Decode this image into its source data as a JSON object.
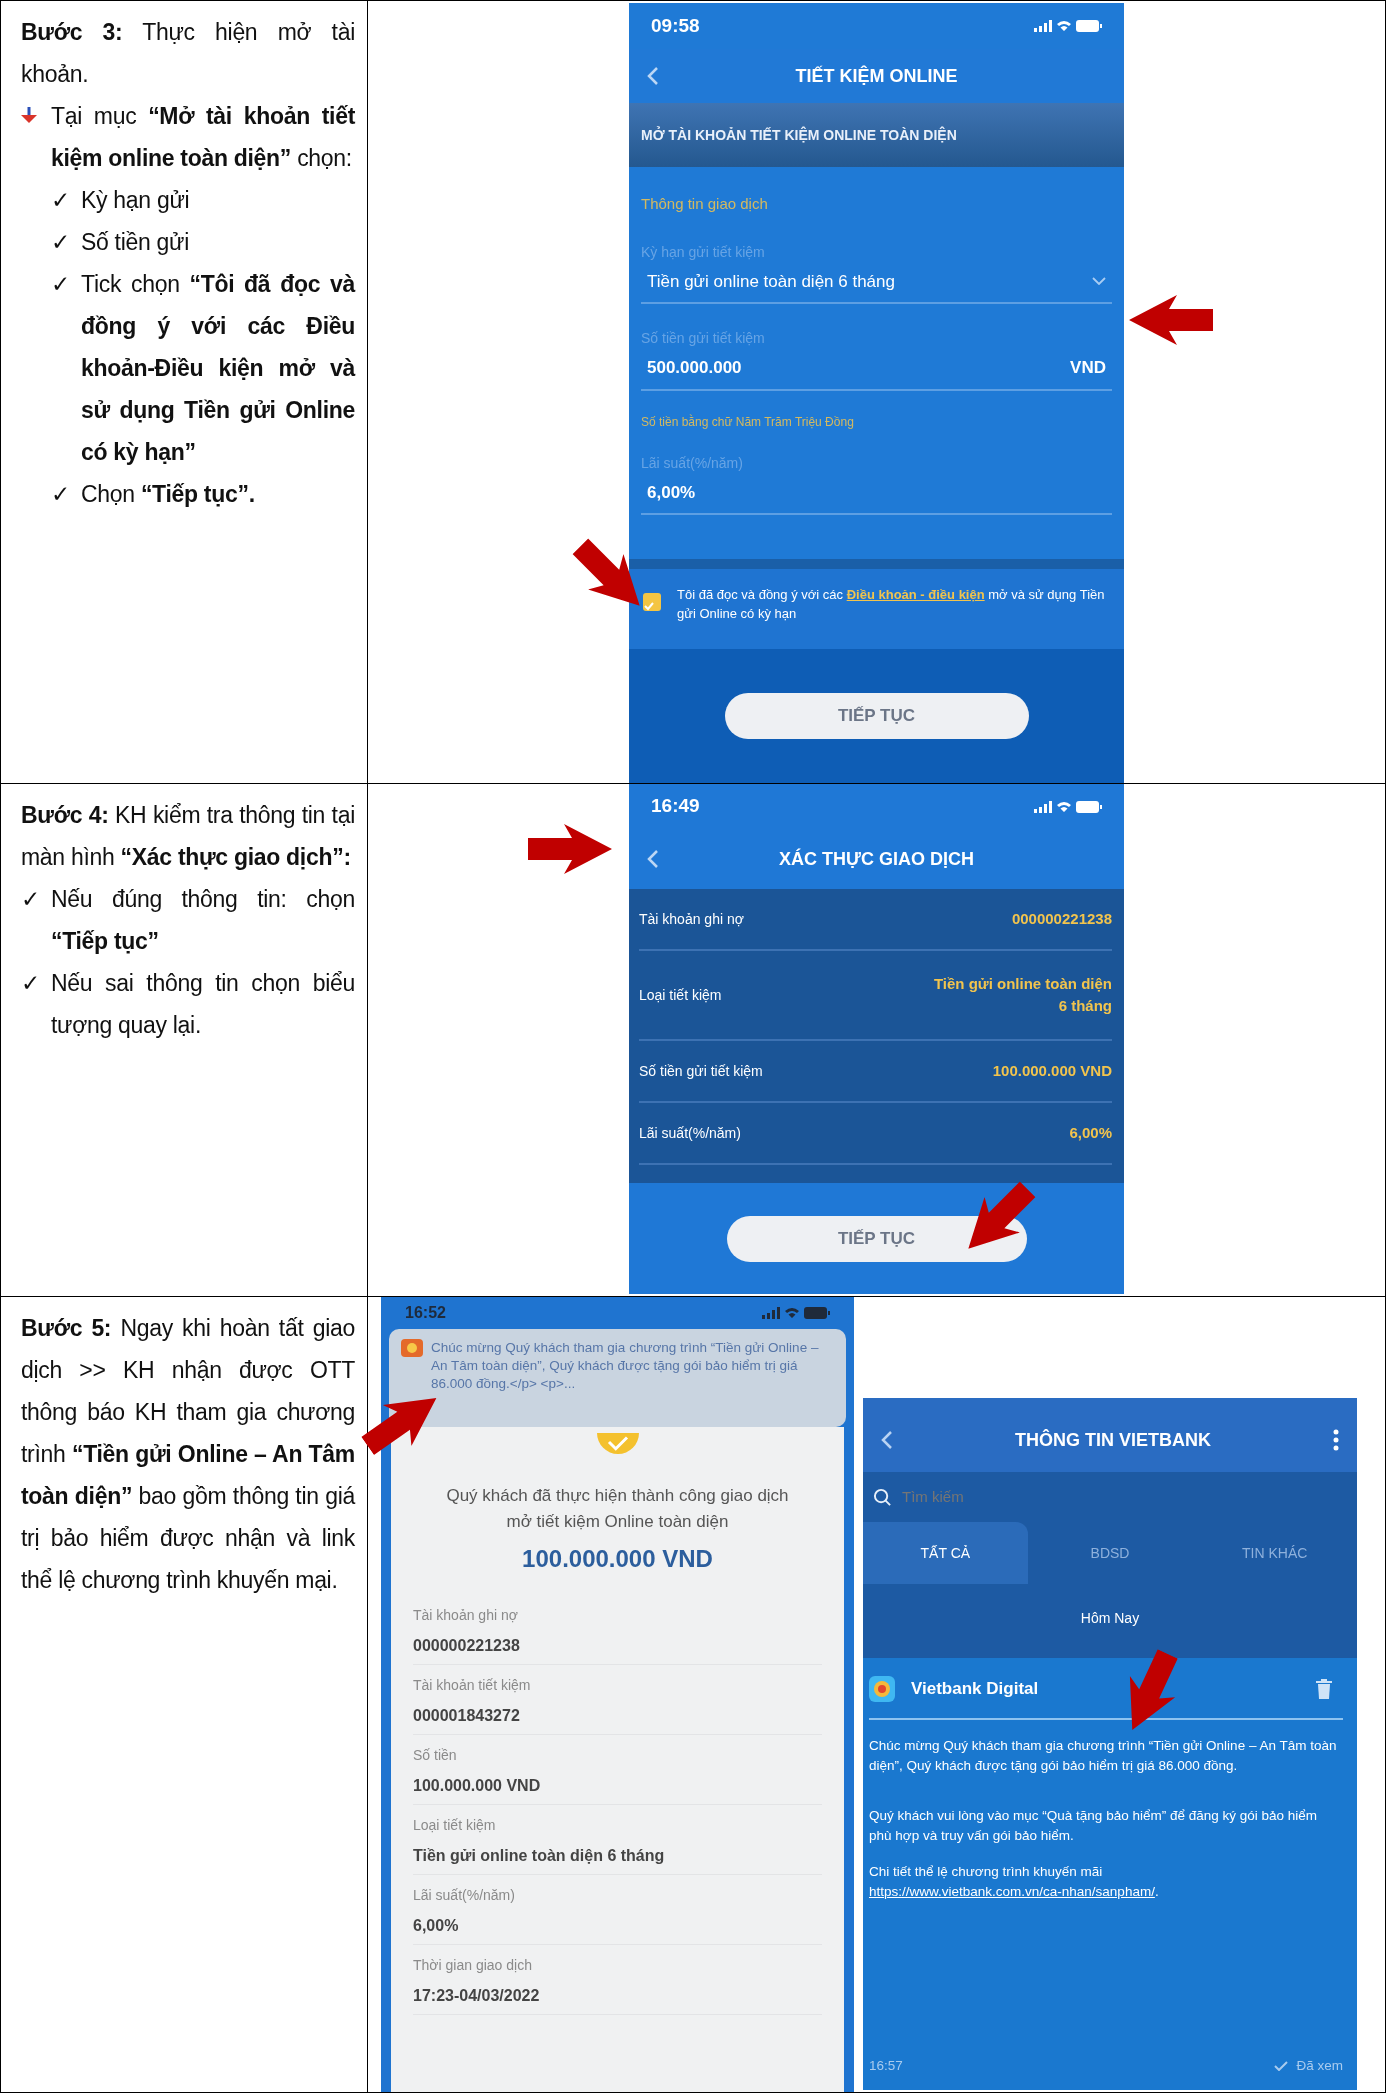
{
  "rows": [
    {
      "instruction": {
        "heading": "**Bước 3:** Thực hiện mở tài khoản.",
        "items": [
          {
            "kind": "arrow",
            "text": "Tại mục **“Mở tài khoản tiết kiệm online toàn diện”** chọn:",
            "children": [
              {
                "kind": "check",
                "mark": "✓",
                "text": "Kỳ hạn gửi"
              },
              {
                "kind": "check",
                "mark": "✓",
                "text": "Số tiền gửi"
              },
              {
                "kind": "check",
                "mark": "✓",
                "text": "Tick chọn **“Tôi đã đọc và đồng ý với các Điều khoản-Điều kiện mở và sử dụng Tiền gửi Online có kỳ hạn”**"
              },
              {
                "kind": "check",
                "mark": "✓",
                "text": "Chọn **“Tiếp tục”.**"
              }
            ]
          }
        ]
      },
      "screens": [
        {
          "kind": "form",
          "time": "09:58",
          "title": "TIẾT KIỆM ONLINE",
          "section": "MỞ TÀI KHOẢN TIẾT KIỆM ONLINE TOÀN DIỆN",
          "group_label": "Thông tin giao dịch",
          "fields": [
            {
              "kind": "select",
              "label": "Kỳ hạn gửi tiết kiệm",
              "value": "Tiền gửi online toàn diện 6 tháng"
            },
            {
              "kind": "amount",
              "label": "Số tiền gửi tiết kiệm",
              "value": "500.000.000",
              "unit": "VND",
              "note": "Số tiền bằng chữ Năm Trăm Triệu Đồng"
            },
            {
              "kind": "text",
              "label": "Lãi suất(%/năm)",
              "value": "6,00%"
            }
          ],
          "agreement": {
            "checked": true,
            "before": "Tôi đã đọc và đồng ý với các",
            "link": "Điều khoản - điều kiện",
            "after": "mở và sử dụng Tiền gửi Online có kỳ hạn"
          },
          "button": "TIẾP TỤC"
        }
      ]
    },
    {
      "instruction": {
        "heading": "**Bước 4:** KH kiểm tra thông tin tại màn hình **“Xác thực giao dịch”:**",
        "items": [
          {
            "kind": "check",
            "mark": "✓",
            "text": "Nếu đúng thông tin: chọn **“Tiếp tục”**"
          },
          {
            "kind": "check",
            "mark": "✓",
            "text": "Nếu sai thông tin chọn biểu tượng quay lại."
          }
        ]
      },
      "screens": [
        {
          "kind": "confirm",
          "time": "16:49",
          "title": "XÁC THỰC GIAO DỊCH",
          "details": [
            {
              "label": "Tài khoản ghi nợ",
              "value": "000000221238"
            },
            {
              "label": "Loại tiết kiệm",
              "value": "Tiền gửi online toàn diện 6 tháng"
            },
            {
              "label": "Số tiền gửi tiết kiệm",
              "value": "100.000.000 VND"
            },
            {
              "label": "Lãi suất(%/năm)",
              "value": "6,00%"
            }
          ],
          "button": "TIẾP TỤC"
        }
      ]
    },
    {
      "instruction": {
        "heading": "**Bước 5:** Ngay khi hoàn tất giao dịch >> KH nhận được OTT thông báo KH tham gia chương trình **“Tiền gửi Online – An Tâm toàn diện”** bao gồm thông tin giá trị bảo hiểm được nhận và link thể lệ chương trình khuyến mại."
      },
      "screens": [
        {
          "kind": "result",
          "time": "16:52",
          "notification": "Chúc mừng Quý khách tham gia chương trình “Tiền gửi Online – An Tâm toàn diện”, Quý khách được tặng gói bảo hiểm trị giá 86.000 đồng.</p>    <p>...",
          "message": "Quý khách đã thực hiện thành công  giao dịch mở tiết kiệm Online toàn diện",
          "amount": "100.000.000 VND",
          "details": [
            {
              "label": "Tài khoản ghi nợ",
              "value": "000000221238"
            },
            {
              "label": "Tài khoản tiết kiệm",
              "value": "000001843272"
            },
            {
              "label": "Số tiền",
              "value": "100.000.000 VND"
            },
            {
              "label": "Loại tiết kiệm",
              "value": "Tiền gửi online toàn diện 6 tháng"
            },
            {
              "label": "Lãi suất(%/năm)",
              "value": "6,00%"
            },
            {
              "label": "Thời gian giao dịch",
              "value": "17:23-04/03/2022"
            }
          ]
        },
        {
          "kind": "inbox",
          "title": "THÔNG TIN VIETBANK",
          "search": {
            "placeholder": "Tìm kiếm"
          },
          "tabs": [
            {
              "label": "TẤT CẢ",
              "selected": true
            },
            {
              "label": "BDSD",
              "selected": false
            },
            {
              "label": "TIN KHÁC",
              "selected": false
            }
          ],
          "day": "Hôm Nay",
          "sender": "Vietbank Digital",
          "paragraphs": [
            "Chúc mừng Quý khách tham gia chương trình “Tiền gửi Online – An Tâm toàn diện”, Quý khách được tặng gói bảo hiểm trị giá 86.000 đồng.",
            "Quý khách vui lòng vào mục “Quà tặng bảo hiểm” để đăng ký gói bảo hiểm phù hợp và truy vấn gói bảo hiểm."
          ],
          "promo": {
            "text": "Chi tiết thể lệ chương trình khuyến mãi",
            "link": "https://www.vietbank.com.vn/ca-nhan/sanpham/",
            "end": "."
          },
          "time": "16:57",
          "status": "Đã xem"
        }
      ]
    }
  ]
}
